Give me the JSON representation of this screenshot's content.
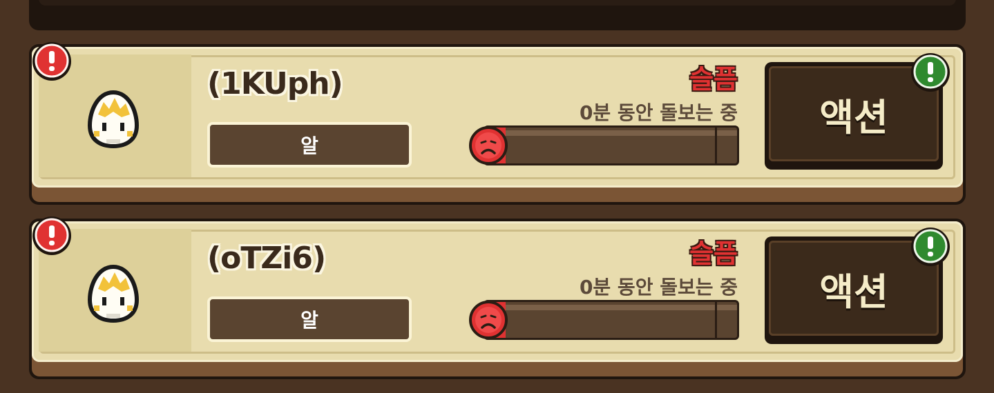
{
  "colors": {
    "background": "#4a3322",
    "card_face": "#e8dcae",
    "name_text": "#3a2a1c",
    "mood_red": "#e03232",
    "alert_red": "#e03232",
    "alert_green": "#2f8a2f",
    "action_button": "#3b2a1b"
  },
  "pets": [
    {
      "name": "(1KUph)",
      "stage": "알",
      "mood": "슬픔",
      "care_time": "0분 동안 돌보는 중",
      "mood_level_fraction": 0.08,
      "action_label": "액션",
      "alert_icon": "exclamation-icon",
      "action_alert_icon": "exclamation-icon",
      "mood_icon": "sad-face-icon",
      "pet_icon": "egg-icon"
    },
    {
      "name": "(oTZi6)",
      "stage": "알",
      "mood": "슬픔",
      "care_time": "0분 동안 돌보는 중",
      "mood_level_fraction": 0.08,
      "action_label": "액션",
      "alert_icon": "exclamation-icon",
      "action_alert_icon": "exclamation-icon",
      "mood_icon": "sad-face-icon",
      "pet_icon": "egg-icon"
    }
  ]
}
